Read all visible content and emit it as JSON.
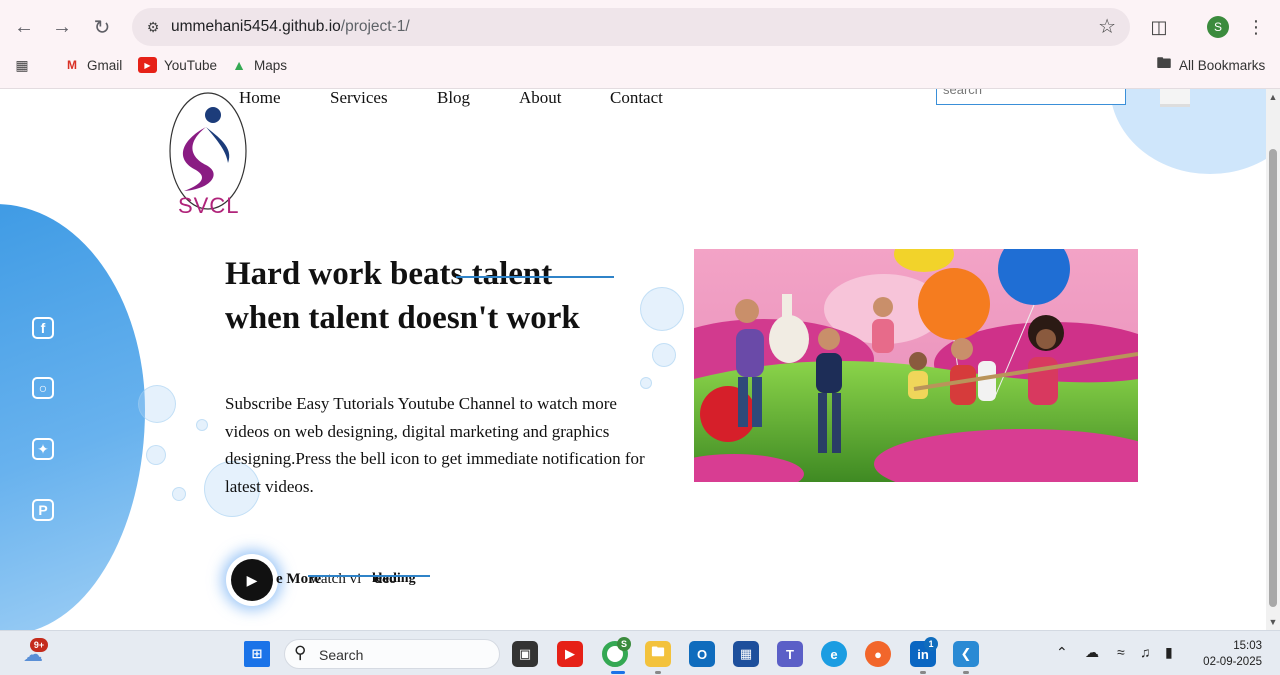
{
  "browser": {
    "url_host": "ummehani5454.github.io",
    "url_path": "/project-1/",
    "profile_initial": "S",
    "bookmarks": [
      {
        "label": "Gmail",
        "icon": "gmail-icon"
      },
      {
        "label": "YouTube",
        "icon": "youtube-icon"
      },
      {
        "label": "Maps",
        "icon": "maps-icon"
      }
    ],
    "all_bookmarks_label": "All Bookmarks"
  },
  "site": {
    "logo_text": "SVCL",
    "nav": [
      "Home",
      "Services",
      "Blog",
      "About",
      "Contact"
    ],
    "search_placeholder": "search",
    "social_icons": [
      "facebook-icon",
      "instagram-icon",
      "twitter-icon",
      "pinterest-icon"
    ],
    "headline_line1": "Hard work beats talent",
    "headline_line2": "when talent doesn't work",
    "description": "Subscribe Easy Tutorials Youtube Channel to watch more videos on web designing, digital marketing and graphics designing.Press the bell icon to get immediate notification for latest videos.",
    "cta_more": "e More",
    "cta_watch": "watch vi",
    "cta_deo": "deo",
    "cta_leading": "leading"
  },
  "taskbar": {
    "search_label": "Search",
    "weather_badge": "9+",
    "teams_badge": "1",
    "chrome_badge": "S",
    "time": "15:03",
    "date": "02-09-2025"
  },
  "colors": {
    "accent_blue": "#3897e3",
    "logo_magenta": "#b0247a",
    "logo_navy": "#1c3c7a"
  }
}
